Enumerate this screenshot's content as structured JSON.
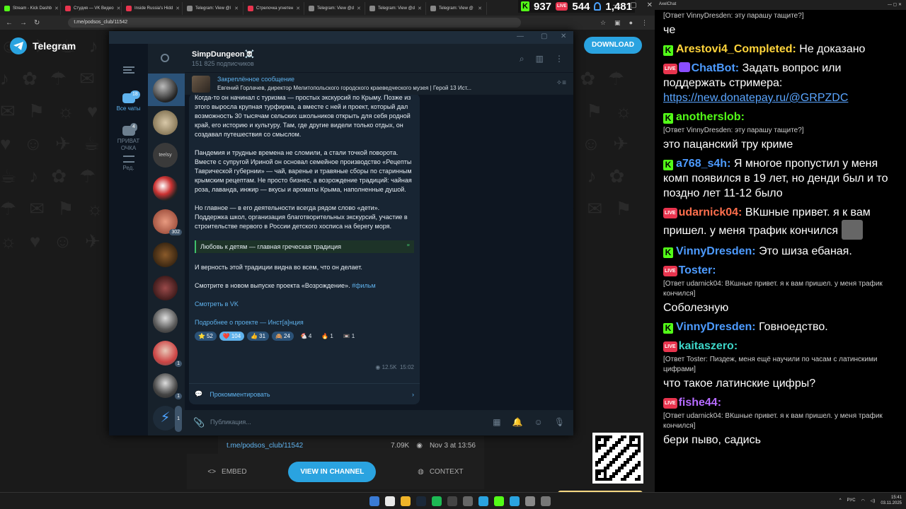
{
  "browser": {
    "tabs": [
      {
        "title": "Stream - Kick Dashb",
        "color": "#53fc18"
      },
      {
        "title": "Студия — VK Видео",
        "color": "#e8344e"
      },
      {
        "title": "Inside Russia's Hidd",
        "color": "#e8344e"
      },
      {
        "title": "Telegram: View @l",
        "color": "#888888"
      },
      {
        "title": "Стрелочка угнетен",
        "color": "#e8344e"
      },
      {
        "title": "Telegram: View @d",
        "color": "#888888"
      },
      {
        "title": "Telegram: View @d",
        "color": "#888888"
      },
      {
        "title": "Telegram: View @",
        "color": "#888888"
      }
    ],
    "url": "t.me/podsos_club/11542",
    "stream_stats": {
      "kick_viewers": "937",
      "vk_viewers": "544",
      "total_viewers": "1,481"
    }
  },
  "tg_web": {
    "logo": "Telegram",
    "download": "DOWNLOAD",
    "post_link": "t.me/podsos_club/11542",
    "post_views": "7.09K",
    "post_date": "Nov 3 at 13:56",
    "embed": "EMBED",
    "view_in_channel": "VIEW IN CHANNEL",
    "context": "CONTEXT"
  },
  "tg_desktop": {
    "folders": [
      {
        "label": "Все чаты",
        "badge": "18"
      },
      {
        "label": "ПРИВАТ ОЧКА",
        "badge": "4"
      },
      {
        "label": "Ред.",
        "badge": ""
      }
    ],
    "chat_counts": {
      "c5": "302",
      "c9": "1",
      "c10": "1",
      "c11": "1"
    },
    "channel_name": "SimpDungeon☠️",
    "subscribers": "151 825 подписчиков",
    "pinned_title": "Закреплённое сообщение",
    "pinned_text": "Евгений Горлачев, директор Мелитопольского городского краеведческого музея | Герой 13  Ист...",
    "message": {
      "p1": "Когда-то он начинал с туризма — простых экскурсий по Крыму. Позже из этого выросла крупная турфирма, а вместе с ней и проект, который дал возможность 30 тысячам сельских школьников открыть для себя родной край, его историю и культуру. Там, где другие видели только отдых, он создавал путешествия со смыслом.",
      "p2": "Пандемия и трудные времена не сломили, а стали точкой поворота. Вместе с супругой Ириной он основал семейное производство «Рецепты Таврической губернии» — чай, варенье и травяные сборы по старинным крымским рецептам. Не просто бизнес, а возрождение традиций: чайная роза, лаванда, инжир — вкусы и ароматы Крыма, наполненные душой.",
      "p3": "Но главное — в его деятельности всегда рядом слово «дети». Поддержка школ, организация благотворительных экскурсий, участие в строительстве первого в России детского хосписа на берегу моря.",
      "quote": "Любовь к детям — главная греческая традиция",
      "p4": "И верность этой традиции видна во всем, что он делает.",
      "p5": "Смотрите в новом выпуске проекта «Возрождение».",
      "hashtag": "#фильм",
      "link1": "Смотреть в VK",
      "link2": "Подробнее о проекте — Инст[а]нция",
      "reactions": [
        {
          "emoji": "⭐",
          "count": "52"
        },
        {
          "emoji": "❤️",
          "count": "104"
        },
        {
          "emoji": "👍",
          "count": "31"
        },
        {
          "emoji": "🙈",
          "count": "24"
        },
        {
          "emoji": "🐔",
          "count": "4"
        },
        {
          "emoji": "🔥",
          "count": "1"
        },
        {
          "emoji": "📼",
          "count": "1"
        }
      ],
      "views": "12.5K",
      "time": "15:02",
      "comment": "Прокомментировать"
    },
    "composer_placeholder": "Публикация..."
  },
  "taskbar": {
    "lang": "РУС",
    "time": "15:41",
    "date": "03.11.2025"
  },
  "chat": {
    "window_title": "AxelChat",
    "messages": [
      {
        "platform": "none",
        "nick": "",
        "color": "#ffffff",
        "reply": "[Ответ VinnyDresden: эту парашу тащите?]",
        "text": "че"
      },
      {
        "platform": "kick",
        "nick": "Arestovi4_Completed:",
        "color": "#ffd43b",
        "reply": "",
        "text": "Не доказано"
      },
      {
        "platform": "vk-bot",
        "nick": "ChatBot:",
        "color": "#4d9bff",
        "reply": "",
        "text": "Задать вопрос или поддержать стримера:",
        "link": "https://new.donatepay.ru/@GRPZDC"
      },
      {
        "platform": "kick",
        "nick": "anotherslob:",
        "color": "#53fc18",
        "reply": "[Ответ VinnyDresden: эту парашу тащите?]",
        "text": "это пацанский тру криме"
      },
      {
        "platform": "kick",
        "nick": "a768_s4h:",
        "color": "#4d9bff",
        "reply": "",
        "text": "Я многое пропустил у меня комп появился в 19 лет, но денди был и то поздно лет 11-12 было"
      },
      {
        "platform": "vk",
        "nick": "udarnick04:",
        "color": "#ff6f4d",
        "reply": "",
        "text": "ВКшные привет. я к вам пришел. у меня трафик кончился"
      },
      {
        "platform": "kick",
        "nick": "VinnyDresden:",
        "color": "#4d9bff",
        "reply": "",
        "text": "Это шиза ебаная."
      },
      {
        "platform": "vk",
        "nick": "Toster:",
        "color": "#4d9bff",
        "reply": "[Ответ udarnick04: ВКшные привет. я к вам пришел. у меня трафик кончился]",
        "text": "Соболезную"
      },
      {
        "platform": "kick",
        "nick": "VinnyDresden:",
        "color": "#4d9bff",
        "reply": "",
        "text": "Говноедство."
      },
      {
        "platform": "vk",
        "nick": "kaitaszero:",
        "color": "#3dd6c8",
        "reply": "[Ответ Toster: Пиздеж, меня ещё научили по часам с латинскими цифрами]",
        "text": "что такое латинские цифры?"
      },
      {
        "platform": "vk",
        "nick": "fishe44:",
        "color": "#b66bff",
        "reply": "[Ответ udarnick04: ВКшные привет. я к вам пришел. у меня трафик кончился]",
        "text": "бери пыво, садись"
      }
    ]
  }
}
